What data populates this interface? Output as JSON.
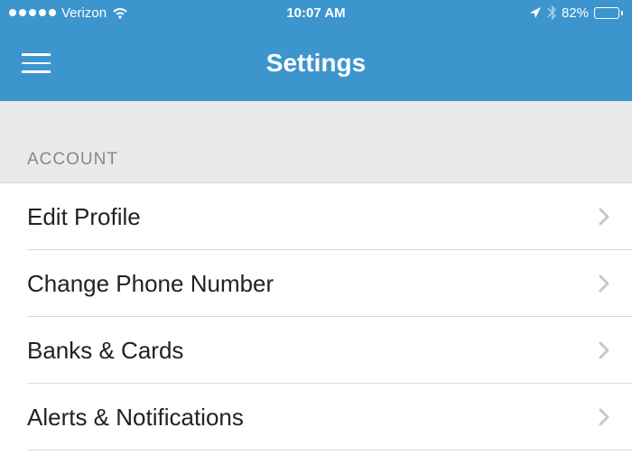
{
  "statusBar": {
    "carrier": "Verizon",
    "time": "10:07 AM",
    "batteryPercent": "82%"
  },
  "nav": {
    "title": "Settings"
  },
  "section": {
    "header": "ACCOUNT",
    "items": [
      {
        "label": "Edit Profile"
      },
      {
        "label": "Change Phone Number"
      },
      {
        "label": "Banks & Cards"
      },
      {
        "label": "Alerts & Notifications"
      }
    ]
  }
}
